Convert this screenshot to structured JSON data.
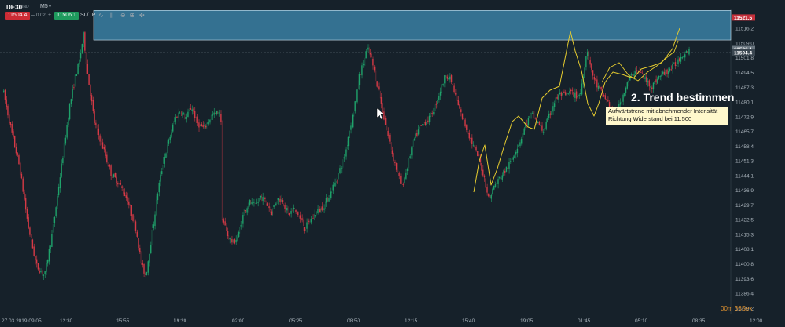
{
  "toolbar": {
    "symbol": "DE30",
    "symbol_sub": "IND",
    "timeframe": "M5",
    "timeframe_caret": "▾",
    "bid": "11504.4",
    "spread_minus": "–",
    "spread": "0.02",
    "spread_plus": "+",
    "ask": "11506.1",
    "sl_tp": "SL/TP",
    "tools": [
      "line-chart-icon",
      "bar-chart-icon",
      "zoom-out-icon",
      "zoom-in-icon",
      "crosshair-icon"
    ]
  },
  "annotation": {
    "title": "2. Trend bestimmen",
    "line1": "Aufwärtstrend mit abnehmender Intensität",
    "line2": "Richtung Widerstand bei 11.500"
  },
  "timer": {
    "minutes": "00m",
    "seconds": "36Sek"
  },
  "colors": {
    "background": "#16212a",
    "bull": "#1fa36b",
    "bear": "#d63a46",
    "zone": "#3a7fa3",
    "trend_line": "#e6cc2f",
    "price_bid": "#cc2c35",
    "price_ask": "#1f9a5e",
    "timer": "#e0922f"
  },
  "chart_data": {
    "type": "candlestick",
    "symbol": "DE30",
    "timeframe": "M5",
    "y_ticks": [
      "11516.2",
      "11509.0",
      "11501.8",
      "11494.5",
      "11487.3",
      "11480.1",
      "11472.9",
      "11465.7",
      "11458.4",
      "11451.3",
      "11444.1",
      "11436.9",
      "11429.7",
      "11422.5",
      "11415.3",
      "11408.1",
      "11400.8",
      "11393.6",
      "11386.4",
      "11379.2"
    ],
    "x_ticks": [
      "27.03.2019 09:05",
      "12:30",
      "15:55",
      "19:20",
      "02:00",
      "05:25",
      "08:50",
      "12:15",
      "15:40",
      "19:05",
      "01:45",
      "05:10",
      "08:35",
      "12:00"
    ],
    "ylim": [
      11376.5,
      11525.5
    ],
    "price_tags": [
      {
        "label": "11521.5",
        "value": 11521.5,
        "kind": "resistance"
      },
      {
        "label": "11506.1",
        "value": 11506.1,
        "kind": "ask"
      },
      {
        "label": "11504.4",
        "value": 11504.4,
        "kind": "bid"
      }
    ],
    "resistance_zone": {
      "low": 11510.5,
      "high": 11525.0
    },
    "close_path": [
      [
        0,
        11486
      ],
      [
        6,
        11466
      ],
      [
        12,
        11448
      ],
      [
        18,
        11420
      ],
      [
        24,
        11400
      ],
      [
        30,
        11395
      ],
      [
        36,
        11418
      ],
      [
        42,
        11448
      ],
      [
        48,
        11478
      ],
      [
        52,
        11492
      ],
      [
        55,
        11500
      ],
      [
        58,
        11513
      ],
      [
        61,
        11494
      ],
      [
        66,
        11470
      ],
      [
        72,
        11458
      ],
      [
        78,
        11445
      ],
      [
        84,
        11440
      ],
      [
        90,
        11432
      ],
      [
        96,
        11418
      ],
      [
        100,
        11400
      ],
      [
        103,
        11395
      ],
      [
        108,
        11418
      ],
      [
        112,
        11438
      ],
      [
        116,
        11452
      ],
      [
        120,
        11462
      ],
      [
        124,
        11472
      ],
      [
        128,
        11476
      ],
      [
        132,
        11472
      ],
      [
        136,
        11478
      ],
      [
        140,
        11470
      ],
      [
        145,
        11467
      ],
      [
        150,
        11473
      ],
      [
        155,
        11475
      ],
      [
        157,
        11476
      ],
      [
        157.5,
        11462
      ],
      [
        158,
        11424
      ],
      [
        162,
        11415
      ],
      [
        166,
        11411
      ],
      [
        170,
        11415
      ],
      [
        174,
        11427
      ],
      [
        178,
        11431
      ],
      [
        182,
        11429
      ],
      [
        186,
        11434
      ],
      [
        190,
        11431
      ],
      [
        194,
        11426
      ],
      [
        198,
        11433
      ],
      [
        202,
        11432
      ],
      [
        206,
        11425
      ],
      [
        210,
        11428
      ],
      [
        214,
        11424
      ],
      [
        218,
        11418
      ],
      [
        222,
        11422
      ],
      [
        226,
        11426
      ],
      [
        230,
        11428
      ],
      [
        234,
        11432
      ],
      [
        238,
        11438
      ],
      [
        242,
        11444
      ],
      [
        246,
        11452
      ],
      [
        250,
        11465
      ],
      [
        254,
        11478
      ],
      [
        257,
        11492
      ],
      [
        260,
        11498
      ],
      [
        263,
        11506
      ],
      [
        266,
        11502
      ],
      [
        270,
        11490
      ],
      [
        273,
        11480
      ],
      [
        276,
        11470
      ],
      [
        280,
        11458
      ],
      [
        284,
        11448
      ],
      [
        288,
        11438
      ],
      [
        292,
        11448
      ],
      [
        296,
        11460
      ],
      [
        300,
        11466
      ],
      [
        304,
        11470
      ],
      [
        308,
        11472
      ],
      [
        312,
        11478
      ],
      [
        316,
        11486
      ],
      [
        320,
        11494
      ],
      [
        324,
        11490
      ],
      [
        328,
        11480
      ],
      [
        332,
        11472
      ],
      [
        336,
        11465
      ],
      [
        340,
        11458
      ],
      [
        344,
        11452
      ],
      [
        348,
        11442
      ],
      [
        351,
        11432
      ],
      [
        354,
        11438
      ],
      [
        358,
        11442
      ],
      [
        362,
        11446
      ],
      [
        366,
        11450
      ],
      [
        370,
        11456
      ],
      [
        374,
        11462
      ],
      [
        378,
        11470
      ],
      [
        382,
        11474
      ],
      [
        386,
        11470
      ],
      [
        390,
        11466
      ],
      [
        394,
        11472
      ],
      [
        398,
        11480
      ],
      [
        402,
        11484
      ],
      [
        406,
        11483
      ],
      [
        410,
        11485
      ],
      [
        414,
        11483
      ],
      [
        417,
        11484
      ],
      [
        420,
        11498
      ],
      [
        422,
        11506
      ],
      [
        425,
        11495
      ],
      [
        429,
        11488
      ],
      [
        433,
        11484
      ],
      [
        437,
        11480
      ],
      [
        441,
        11472
      ],
      [
        445,
        11478
      ],
      [
        449,
        11486
      ],
      [
        453,
        11492
      ],
      [
        457,
        11496
      ],
      [
        461,
        11494
      ],
      [
        465,
        11490
      ],
      [
        469,
        11488
      ],
      [
        473,
        11492
      ],
      [
        477,
        11494
      ],
      [
        481,
        11496
      ],
      [
        485,
        11498
      ],
      [
        489,
        11502
      ],
      [
        493,
        11505
      ],
      [
        496,
        11506
      ]
    ]
  }
}
